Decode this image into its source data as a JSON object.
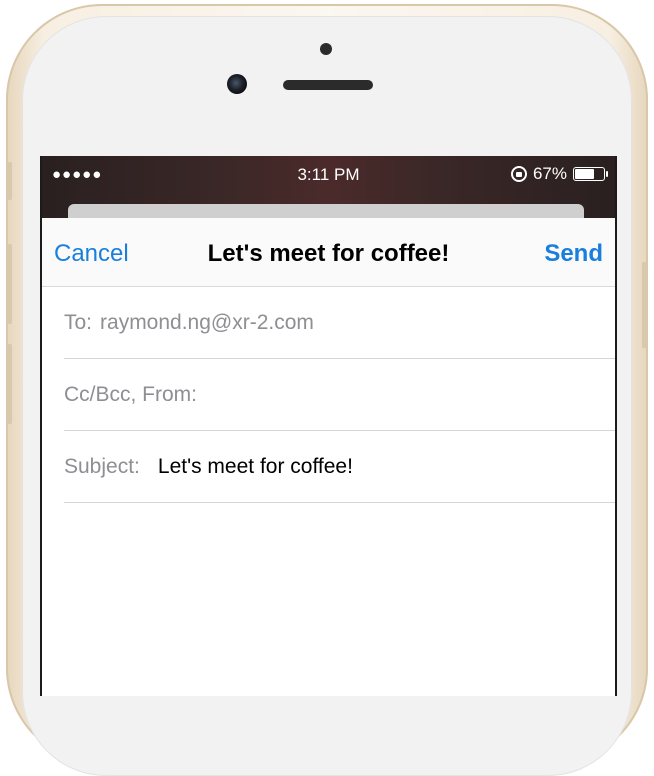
{
  "status_bar": {
    "signal": "●●●●●",
    "time": "3:11 PM",
    "battery_percent": "67%",
    "battery_level": 0.67
  },
  "navbar": {
    "cancel_label": "Cancel",
    "title": "Let's meet for coffee!",
    "send_label": "Send"
  },
  "fields": {
    "to_label": "To:",
    "to_value": "raymond.ng@xr-2.com",
    "cc_label": "Cc/Bcc, From:",
    "subject_label": "Subject:",
    "subject_value": "Let's meet for coffee!"
  },
  "colors": {
    "accent": "#1a7fdc",
    "label_gray": "#8e8e93"
  }
}
